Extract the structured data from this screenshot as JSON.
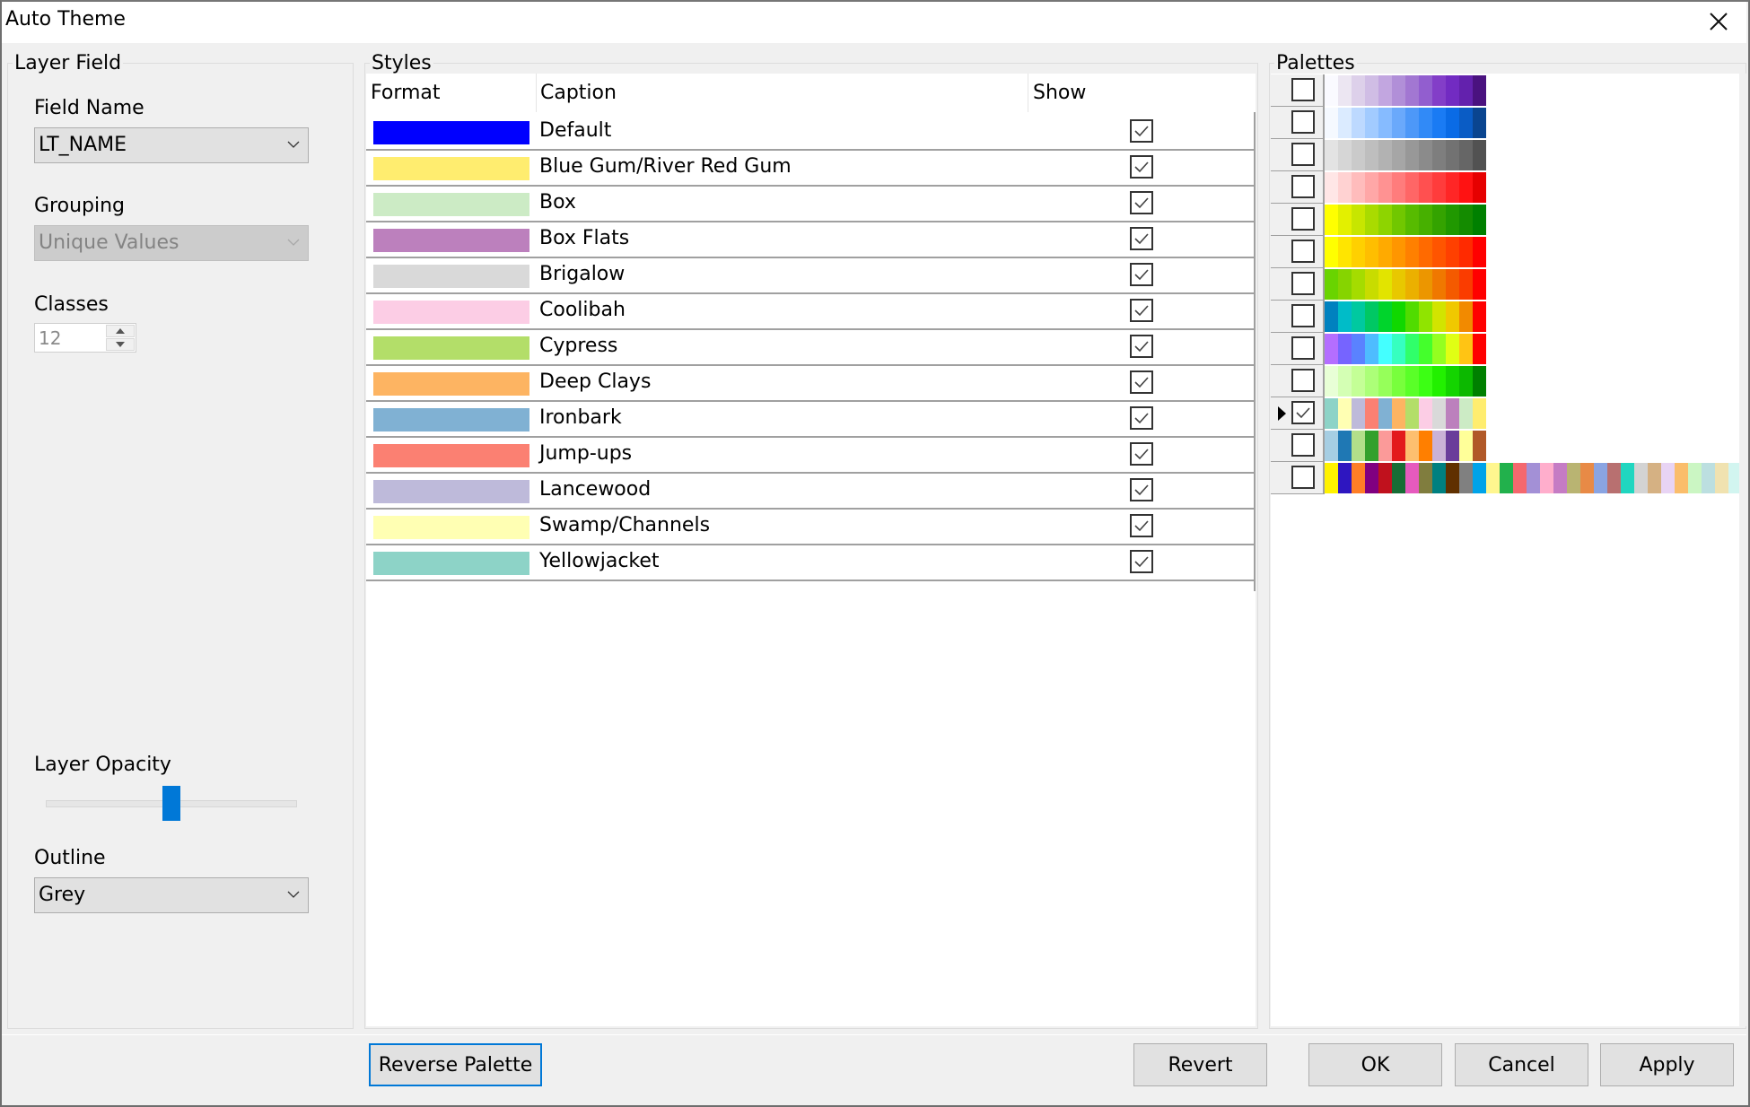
{
  "window": {
    "title": "Auto Theme",
    "close_icon": "close-icon"
  },
  "layer_field": {
    "group_label": "Layer Field",
    "field_name": {
      "label": "Field Name",
      "value": "LT_NAME"
    },
    "grouping": {
      "label": "Grouping",
      "value": "Unique Values",
      "disabled": true
    },
    "classes": {
      "label": "Classes",
      "value": "12",
      "disabled": true
    },
    "layer_opacity": {
      "label": "Layer Opacity",
      "value_fraction": 0.5
    },
    "outline": {
      "label": "Outline",
      "value": "Grey"
    }
  },
  "styles": {
    "group_label": "Styles",
    "columns": [
      "Format",
      "Caption",
      "Show"
    ],
    "rows": [
      {
        "color": "#0000ff",
        "caption": "Default",
        "show": true
      },
      {
        "color": "#ffed6f",
        "caption": "Blue Gum/River Red Gum",
        "show": true
      },
      {
        "color": "#ccebc5",
        "caption": "Box",
        "show": true
      },
      {
        "color": "#bc80bd",
        "caption": "Box Flats",
        "show": true
      },
      {
        "color": "#d9d9d9",
        "caption": "Brigalow",
        "show": true
      },
      {
        "color": "#fccde5",
        "caption": "Coolibah",
        "show": true
      },
      {
        "color": "#b3de69",
        "caption": "Cypress",
        "show": true
      },
      {
        "color": "#fdb462",
        "caption": "Deep Clays",
        "show": true
      },
      {
        "color": "#80b1d3",
        "caption": "Ironbark",
        "show": true
      },
      {
        "color": "#fb8072",
        "caption": "Jump-ups",
        "show": true
      },
      {
        "color": "#bebada",
        "caption": "Lancewood",
        "show": true
      },
      {
        "color": "#ffffb3",
        "caption": "Swamp/Channels",
        "show": true
      },
      {
        "color": "#8dd3c7",
        "caption": "Yellowjacket",
        "show": true
      }
    ]
  },
  "palettes": {
    "group_label": "Palettes",
    "items": [
      {
        "selected": false,
        "current": false,
        "colors": [
          "#fafaff",
          "#ece6f2",
          "#ddd0ea",
          "#d0bde5",
          "#c2a6e0",
          "#b18fd8",
          "#a277d2",
          "#925ecf",
          "#833ec8",
          "#722bc2",
          "#6321ad",
          "#4a127f"
        ]
      },
      {
        "selected": false,
        "current": false,
        "colors": [
          "#f5f9ff",
          "#dbebff",
          "#bdd9ff",
          "#a2cbff",
          "#86bbff",
          "#6aa9fb",
          "#4d98f8",
          "#318af7",
          "#1a7bf4",
          "#0a6be6",
          "#0a5cc5",
          "#0a4590"
        ]
      },
      {
        "selected": false,
        "current": false,
        "colors": [
          "#e3e3e3",
          "#d6d6d6",
          "#cacaca",
          "#bebebe",
          "#b2b2b2",
          "#a6a6a6",
          "#989898",
          "#8b8b8b",
          "#7e7e7e",
          "#727272",
          "#666666",
          "#525252"
        ]
      },
      {
        "selected": false,
        "current": false,
        "colors": [
          "#ffe6e6",
          "#ffd2d2",
          "#ffbcbc",
          "#ffa7a7",
          "#ff9292",
          "#ff7c7c",
          "#ff6666",
          "#ff5050",
          "#ff3c3c",
          "#ff2626",
          "#ff1212",
          "#e60000"
        ]
      },
      {
        "selected": false,
        "current": false,
        "colors": [
          "#ffff00",
          "#e3f000",
          "#c7e600",
          "#a9db00",
          "#8ed400",
          "#71c700",
          "#57bb00",
          "#47b000",
          "#34a300",
          "#209800",
          "#148b00",
          "#008000"
        ]
      },
      {
        "selected": false,
        "current": false,
        "colors": [
          "#ffff00",
          "#ffe500",
          "#ffd000",
          "#ffbe00",
          "#ffaa00",
          "#ff9600",
          "#ff8000",
          "#ff6a00",
          "#ff5500",
          "#ff4000",
          "#ff2a00",
          "#ff0000"
        ]
      },
      {
        "selected": false,
        "current": false,
        "colors": [
          "#69d400",
          "#86d400",
          "#a5dc00",
          "#c8dc00",
          "#e2e400",
          "#e8c800",
          "#ebb000",
          "#ec9600",
          "#f07800",
          "#f45a00",
          "#fa3c00",
          "#ff0000"
        ]
      },
      {
        "selected": false,
        "current": false,
        "colors": [
          "#0081bf",
          "#00bcc8",
          "#00c9a0",
          "#00c864",
          "#00d42c",
          "#10d800",
          "#50dc00",
          "#90e400",
          "#d2e400",
          "#f0c800",
          "#f28a00",
          "#ff0000"
        ]
      },
      {
        "selected": false,
        "current": false,
        "colors": [
          "#b46eff",
          "#7664ff",
          "#5a82ff",
          "#4ebcff",
          "#44ffff",
          "#36ffc0",
          "#30ff6a",
          "#44ff2c",
          "#94ff20",
          "#e0ff14",
          "#ffc414",
          "#ff0000"
        ]
      },
      {
        "selected": false,
        "current": false,
        "colors": [
          "#e8ffd6",
          "#d4ffb4",
          "#c4ff96",
          "#acff78",
          "#96ff5a",
          "#78ff3c",
          "#5aff28",
          "#3cff14",
          "#22f000",
          "#14d400",
          "#0cb800",
          "#008000"
        ]
      },
      {
        "selected": true,
        "current": true,
        "colors": [
          "#8dd3c7",
          "#ffffb3",
          "#bebada",
          "#fb8072",
          "#80b1d3",
          "#fdb462",
          "#b3de69",
          "#fccde5",
          "#d9d9d9",
          "#bc80bd",
          "#ccebc5",
          "#ffed6f"
        ]
      },
      {
        "selected": false,
        "current": false,
        "colors": [
          "#a6cee3",
          "#1f78b4",
          "#b2df8a",
          "#33a02c",
          "#fb9a99",
          "#e31a1c",
          "#fdbf6f",
          "#ff7f00",
          "#cab2d6",
          "#6a3d9a",
          "#ffff99",
          "#b15928"
        ]
      },
      {
        "selected": false,
        "current": false,
        "colors": [
          "#fff200",
          "#2e16c0",
          "#ff7e26",
          "#800080",
          "#c0111d",
          "#176d35",
          "#e65abe",
          "#807d3e",
          "#008080",
          "#603000",
          "#808080",
          "#00a3e8",
          "#fff68f",
          "#22b14c",
          "#f4686e",
          "#a390d6",
          "#ffaecc",
          "#c57cc4",
          "#b9b472",
          "#e88a46",
          "#8aa4e2",
          "#b87070",
          "#20d6c0",
          "#d3d3d3",
          "#d5b183",
          "#e8d4f4",
          "#fabd6b",
          "#cbf6c3",
          "#bcdfe0",
          "#f0e2b0",
          "#d2f5f0",
          "#fde6ee"
        ]
      }
    ]
  },
  "buttons": {
    "reverse_palette": "Reverse Palette",
    "revert": "Revert",
    "ok": "OK",
    "cancel": "Cancel",
    "apply": "Apply"
  }
}
